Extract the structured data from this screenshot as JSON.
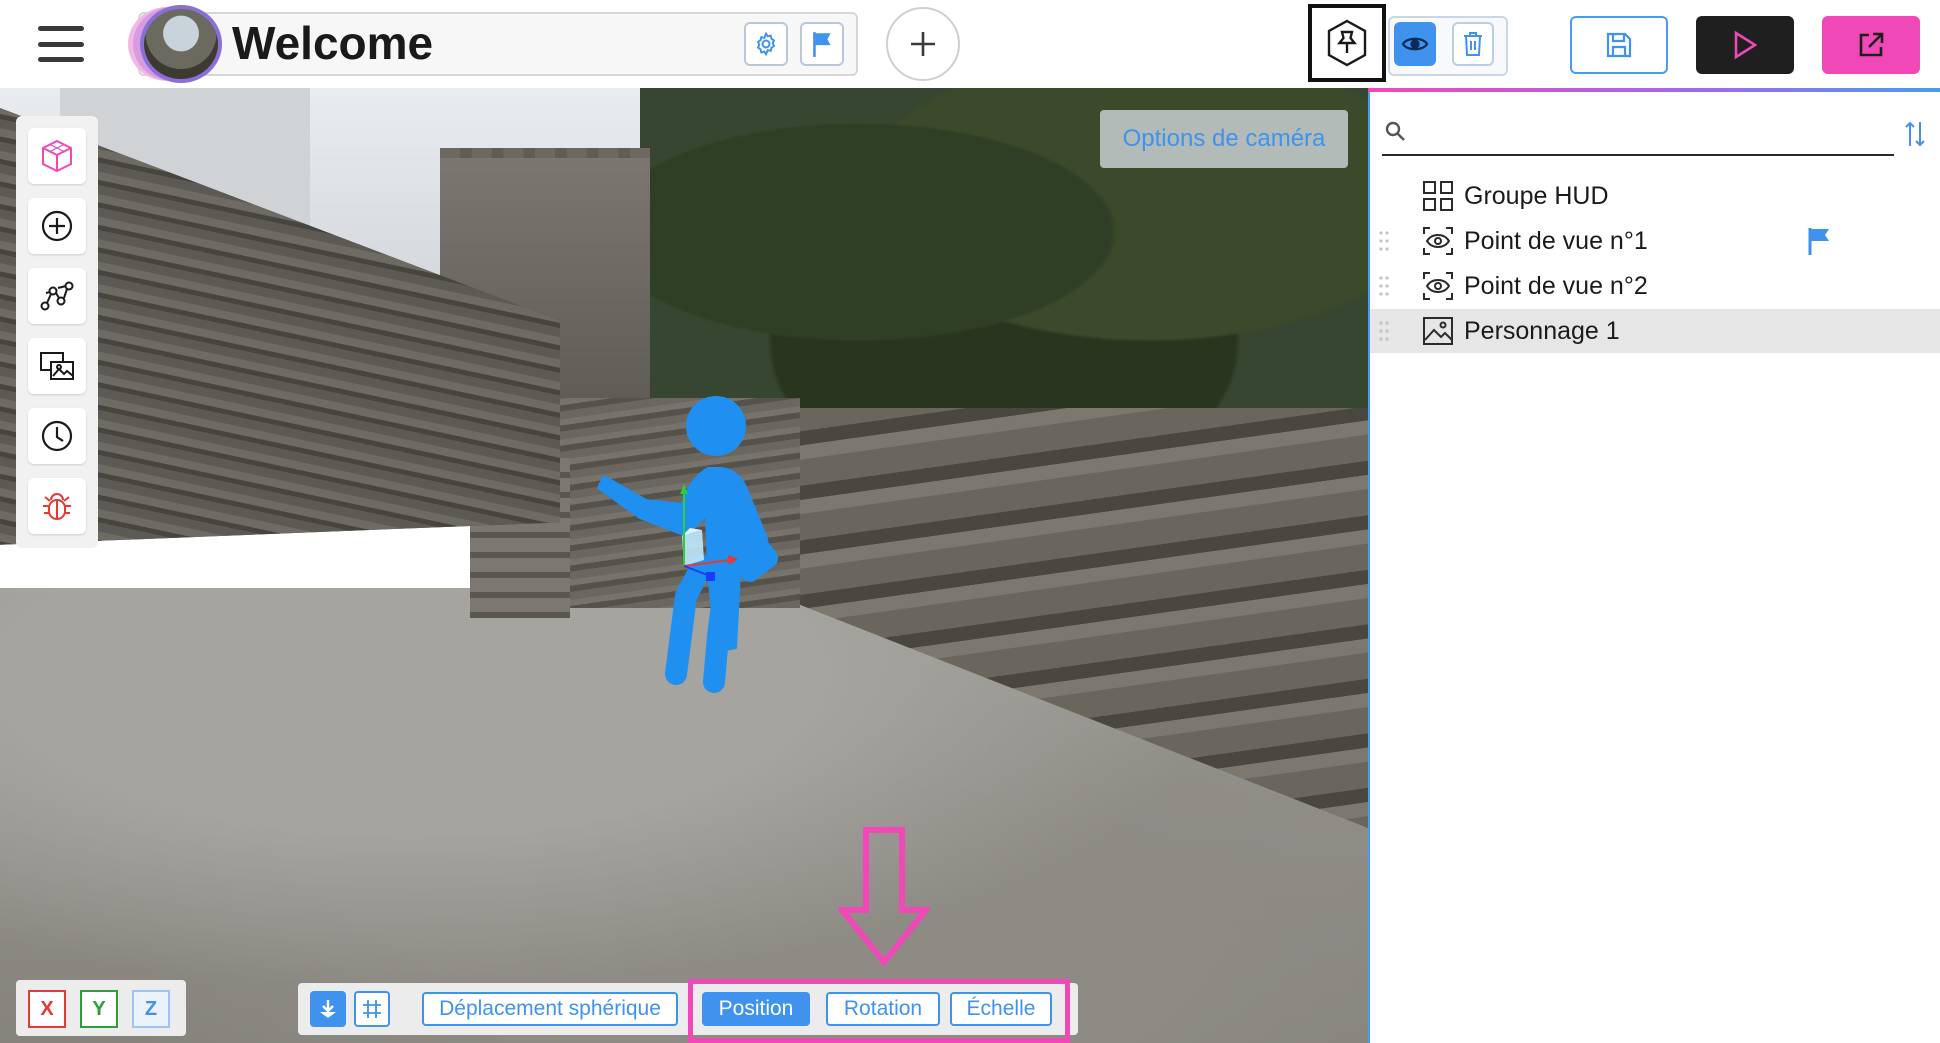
{
  "header": {
    "title": "Welcome",
    "menu_icon": "hamburger-menu-icon",
    "settings_icon": "gear-icon",
    "flag_icon": "flag-icon",
    "add_icon": "plus-icon",
    "pin_icon": "pin-icon",
    "visibility_icon": "eye-icon",
    "delete_icon": "trash-icon",
    "save_icon": "save-icon",
    "play_icon": "play-icon",
    "export_icon": "external-link-icon"
  },
  "colors": {
    "accent": "#3f92ee",
    "pink": "#f048b6",
    "dark": "#1f1f1f",
    "axis_x": "#e53935",
    "axis_y": "#2e9e3a",
    "axis_z": "#3f92ee"
  },
  "viewport": {
    "camera_options_label": "Options de caméra",
    "left_toolbar": [
      {
        "icon": "cube-icon"
      },
      {
        "icon": "add-circle-icon"
      },
      {
        "icon": "graph-nodes-icon"
      },
      {
        "icon": "images-icon"
      },
      {
        "icon": "clock-icon"
      },
      {
        "icon": "bug-icon"
      }
    ],
    "axes": [
      "X",
      "Y",
      "Z"
    ],
    "bottom_bar": {
      "snap_icon": "snap-down-icon",
      "grid_icon": "grid-icon",
      "spherical_label": "Déplacement sphérique",
      "position_label": "Position",
      "rotation_label": "Rotation",
      "scale_label": "Échelle",
      "active_mode": "Position"
    }
  },
  "panel": {
    "search_value": "",
    "search_icon": "search-icon",
    "sort_icon": "sort-icon",
    "items": [
      {
        "label": "Groupe HUD",
        "icon": "grid-group-icon",
        "flag": false,
        "selected": false
      },
      {
        "label": "Point de vue n°1",
        "icon": "viewpoint-eye-icon",
        "flag": true,
        "selected": false
      },
      {
        "label": "Point de vue n°2",
        "icon": "viewpoint-eye-icon",
        "flag": false,
        "selected": false
      },
      {
        "label": "Personnage 1",
        "icon": "image-icon",
        "flag": false,
        "selected": true
      }
    ]
  }
}
